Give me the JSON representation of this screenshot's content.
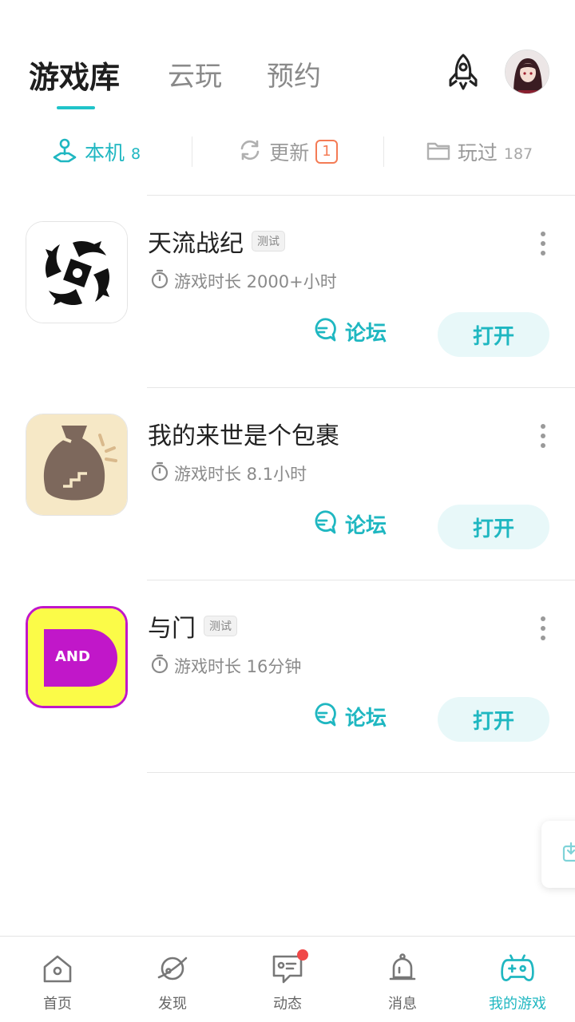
{
  "top_tabs": [
    {
      "label": "游戏库",
      "active": true
    },
    {
      "label": "云玩",
      "active": false
    },
    {
      "label": "预约",
      "active": false
    }
  ],
  "sub_tabs": [
    {
      "label": "本机",
      "count": "8",
      "icon": "phone-stand-icon",
      "active": true
    },
    {
      "label": "更新",
      "badge": "1",
      "icon": "refresh-icon",
      "active": false
    },
    {
      "label": "玩过",
      "count": "187",
      "icon": "folder-icon",
      "active": false
    }
  ],
  "games": [
    {
      "name": "天流战纪",
      "tag": "测试",
      "playtime": "游戏时长 2000+小时",
      "forum_label": "论坛",
      "open_label": "打开",
      "icon": "swirl-logo"
    },
    {
      "name": "我的来世是个包裹",
      "tag": "",
      "playtime": "游戏时长 8.1小时",
      "forum_label": "论坛",
      "open_label": "打开",
      "icon": "sack-logo"
    },
    {
      "name": "与门",
      "tag": "测试",
      "playtime": "游戏时长 16分钟",
      "forum_label": "论坛",
      "open_label": "打开",
      "icon": "and-gate-logo",
      "icon_text": "AND"
    }
  ],
  "bottom_nav": [
    {
      "label": "首页",
      "icon": "home-icon",
      "active": false
    },
    {
      "label": "发现",
      "icon": "planet-icon",
      "active": false
    },
    {
      "label": "动态",
      "icon": "chat-card-icon",
      "active": false,
      "dot": true
    },
    {
      "label": "消息",
      "icon": "bell-icon",
      "active": false
    },
    {
      "label": "我的游戏",
      "icon": "gamepad-icon",
      "active": true
    }
  ],
  "colors": {
    "accent": "#1fb7c1",
    "badge": "#f47b55",
    "dot": "#f04848"
  }
}
